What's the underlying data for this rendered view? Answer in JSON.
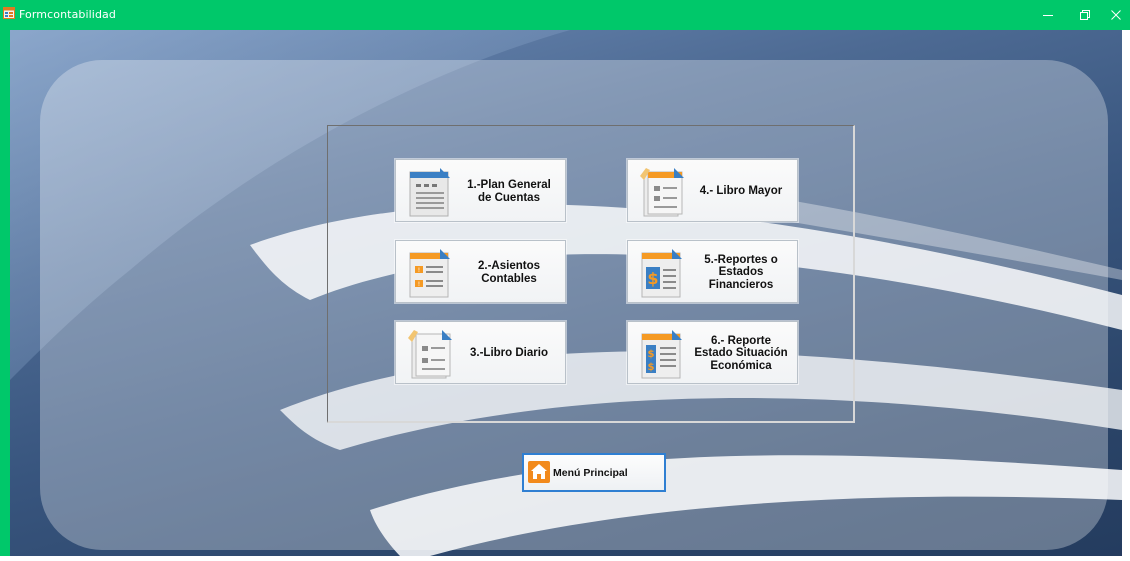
{
  "window": {
    "title": "Formcontabilidad",
    "controls": [
      "minimize",
      "maximize",
      "close"
    ]
  },
  "colors": {
    "titlebar": "#00c86a",
    "background_blue": "#3c5a84",
    "home_button_border": "#2f7fd2",
    "icon_orange": "#f59a24",
    "icon_blue": "#3a7fc4"
  },
  "menu": {
    "buttons": [
      {
        "label": "1.-Plan General\nde Cuentas",
        "icon": "document-list-icon"
      },
      {
        "label": "4.- Libro Mayor",
        "icon": "ledger-icon"
      },
      {
        "label": "2.-Asientos\nContables",
        "icon": "entries-icon"
      },
      {
        "label": "5.-Reportes o\nEstados\nFinancieros",
        "icon": "dollar-report-icon"
      },
      {
        "label": "3.-Libro Diario",
        "icon": "journal-icon"
      },
      {
        "label": "6.- Reporte\nEstado Situación\nEconómica",
        "icon": "dollar-document-icon"
      }
    ]
  },
  "home": {
    "label": "Menú Principal",
    "icon": "home-icon"
  }
}
